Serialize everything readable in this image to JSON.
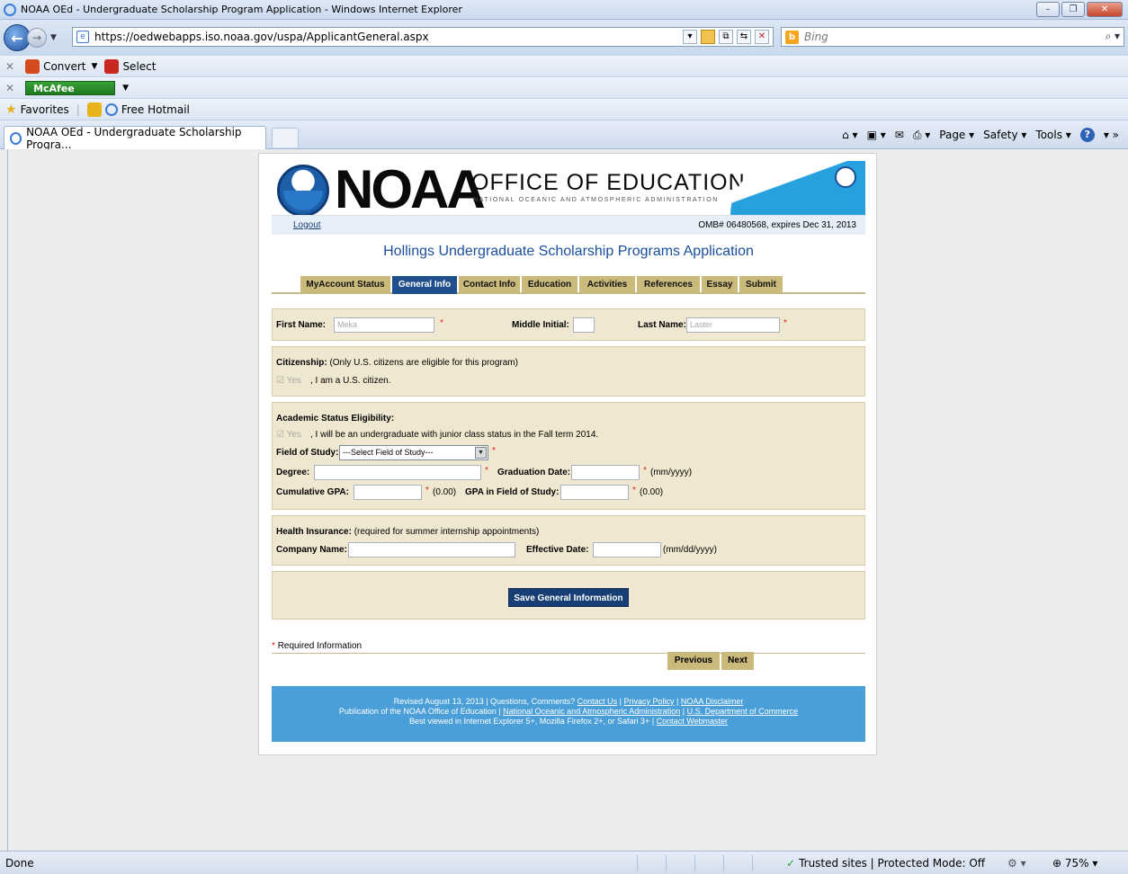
{
  "browser": {
    "window_title": "NOAA OEd - Undergraduate Scholarship Program Application - Windows Internet Explorer",
    "url": "https://oedwebapps.iso.noaa.gov/uspa/ApplicantGeneral.aspx",
    "search_placeholder": "Bing",
    "toolbar_convert": "Convert",
    "toolbar_select": "Select",
    "mcafee": "McAfee",
    "favorites": "Favorites",
    "free_hotmail": "Free Hotmail",
    "tab_title": "NOAA OEd - Undergraduate Scholarship Progra...",
    "cmd_page": "Page",
    "cmd_safety": "Safety",
    "cmd_tools": "Tools",
    "status_done": "Done",
    "status_trusted": "Trusted sites | Protected Mode: Off",
    "zoom": "75%"
  },
  "header": {
    "noaa": "NOAA",
    "office": "OFFICE OF EDUCATION",
    "office_sub": "NATIONAL OCEANIC AND ATMOSPHERIC ADMINISTRATION",
    "logout": "Logout",
    "omb": "OMB# 06480568, expires Dec 31, 2013",
    "app_title": "Hollings Undergraduate Scholarship Programs Application"
  },
  "tabs": [
    "MyAccount Status",
    "General Info",
    "Contact Info",
    "Education",
    "Activities",
    "References",
    "Essay",
    "Submit"
  ],
  "name_section": {
    "first_label": "First Name:",
    "first_value": "Meka",
    "middle_label": "Middle Initial:",
    "last_label": "Last Name:",
    "last_value": "Laster"
  },
  "citizenship": {
    "heading": "Citizenship:",
    "note": "(Only U.S. citizens are eligible for this program)",
    "yes": "Yes",
    "text": ", I am a U.S. citizen."
  },
  "academic": {
    "heading": "Academic Status Eligibility:",
    "yes": "Yes",
    "text": ", I will be an undergraduate with junior class status in the Fall term 2014.",
    "field_label": "Field of Study:",
    "field_value": "---Select Field of Study---",
    "degree_label": "Degree:",
    "grad_label": "Graduation Date:",
    "grad_hint": "(mm/yyyy)",
    "gpa_label": "Cumulative GPA:",
    "gpa_hint": "(0.00)",
    "gpa_field_label": "GPA in Field of Study:",
    "gpa_field_hint": "(0.00)"
  },
  "insurance": {
    "heading": "Health Insurance:",
    "note": "(required for summer internship appointments)",
    "company_label": "Company Name:",
    "date_label": "Effective Date:",
    "date_hint": "(mm/dd/yyyy)"
  },
  "save_button": "Save General Information",
  "required_info": "Required Information",
  "nav": {
    "previous": "Previous",
    "next": "Next"
  },
  "footer": {
    "line1_text": "Revised August 13, 2013 | Questions, Comments?",
    "contact_us": "Contact Us",
    "privacy": "Privacy Policy",
    "disclaimer": "NOAA Disclaimer",
    "line2_text": "Publication of the NOAA Office of Education |",
    "noaa_link": "National Oceanic and Atmospheric Administration",
    "doc_link": "U.S. Department of Commerce",
    "line3_text": "Best viewed in Internet Explorer 5+, Mozilla Firefox 2+, or Safari 3+ |",
    "webmaster": "Contact Webmaster"
  }
}
